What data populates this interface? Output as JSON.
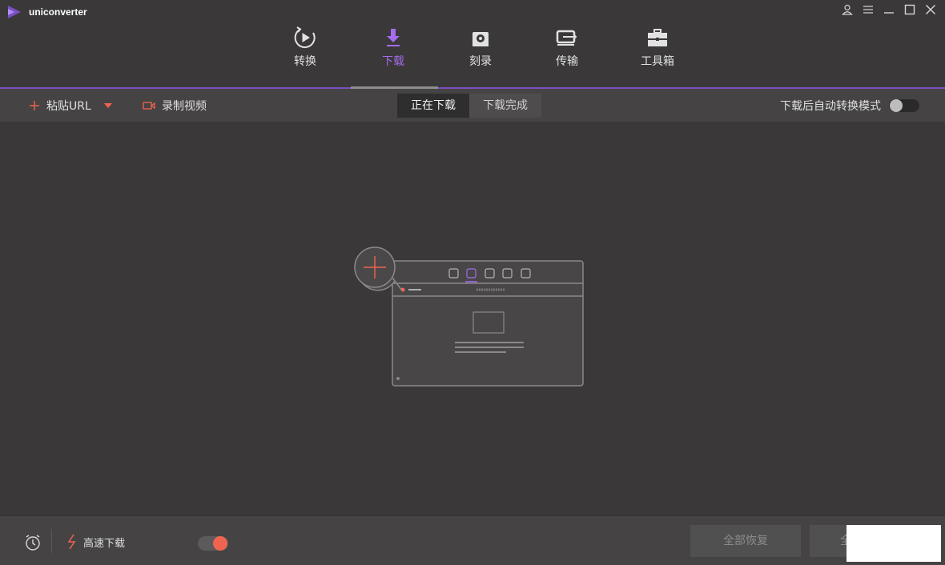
{
  "app": {
    "title": "uniconverter"
  },
  "nav": {
    "items": [
      {
        "label": "转换",
        "icon": "play-circle-icon"
      },
      {
        "label": "下载",
        "icon": "download-arrow-icon",
        "active": true
      },
      {
        "label": "刻录",
        "icon": "disc-burn-icon"
      },
      {
        "label": "传输",
        "icon": "transfer-device-icon"
      },
      {
        "label": "工具箱",
        "icon": "toolbox-icon"
      }
    ]
  },
  "toolbar": {
    "paste_label": "粘贴URL",
    "record_label": "录制视频",
    "tabs": [
      {
        "label": "正在下载",
        "active": true
      },
      {
        "label": "下载完成",
        "active": false
      }
    ],
    "auto_convert_label": "下载后自动转换模式",
    "auto_convert_on": false
  },
  "footer": {
    "high_speed_label": "高速下载",
    "high_speed_on": true,
    "resume_all_label": "全部恢复",
    "pause_all_label": "全"
  },
  "colors": {
    "accent": "#a66cf0",
    "accent_line": "#7a4fc2",
    "brand_red": "#f0644f",
    "bg": "#3a3838",
    "toolbar_bg": "#454343"
  }
}
